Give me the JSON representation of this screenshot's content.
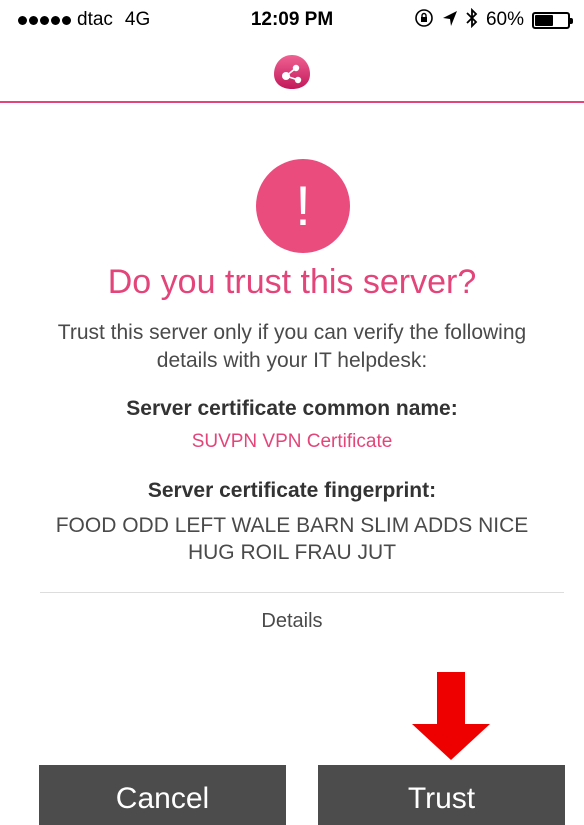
{
  "status_bar": {
    "carrier": "dtac",
    "network": "4G",
    "time": "12:09 PM",
    "battery_percent": "60%",
    "battery_level": 0.6,
    "icons": [
      "orientation-lock-icon",
      "location-arrow-icon",
      "bluetooth-icon"
    ]
  },
  "header": {
    "logo_icon": "app-logo-icon"
  },
  "dialog": {
    "icon": "exclamation-icon",
    "icon_glyph": "!",
    "title": "Do you trust this server?",
    "intro": "Trust this server only if you can verify the following details with your IT helpdesk:",
    "common_name_label": "Server certificate common name:",
    "common_name_value": "SUVPN VPN Certificate",
    "fingerprint_label": "Server certificate fingerprint:",
    "fingerprint_value": "FOOD ODD LEFT WALE BARN SLIM ADDS NICE HUG ROIL FRAU JUT",
    "details_label": "Details"
  },
  "buttons": {
    "cancel_label": "Cancel",
    "trust_label": "Trust"
  },
  "annotation": {
    "arrow_color": "#ee0000",
    "arrow_direction": "down"
  },
  "colors": {
    "accent": "#e3457a",
    "button_bg": "#4c4c4c"
  }
}
